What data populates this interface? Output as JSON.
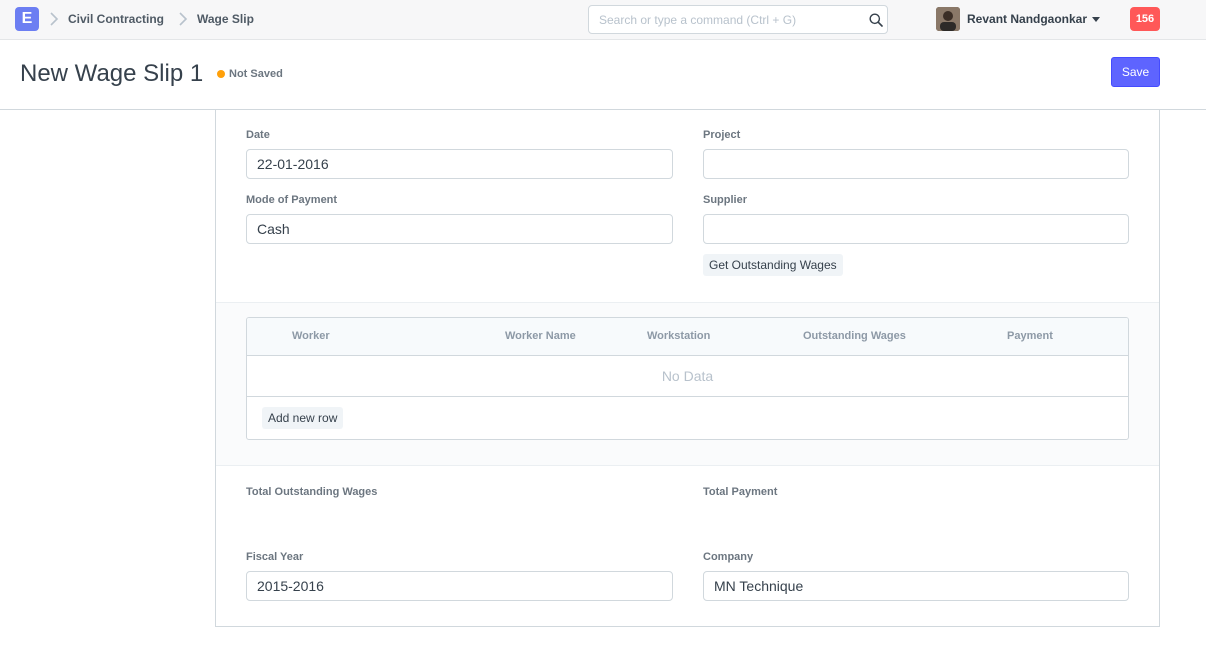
{
  "navbar": {
    "logo_letter": "E",
    "breadcrumbs": [
      "Civil Contracting",
      "Wage Slip"
    ],
    "search_placeholder": "Search or type a command (Ctrl + G)",
    "user_name": "Revant Nandgaonkar",
    "notification_count": "156"
  },
  "page": {
    "title": "New Wage Slip 1",
    "status": "Not Saved",
    "save_label": "Save"
  },
  "form": {
    "date": {
      "label": "Date",
      "value": "22-01-2016"
    },
    "project": {
      "label": "Project",
      "value": ""
    },
    "mode_of_payment": {
      "label": "Mode of Payment",
      "value": "Cash"
    },
    "supplier": {
      "label": "Supplier",
      "value": ""
    },
    "get_outstanding_label": "Get Outstanding Wages",
    "total_outstanding_label": "Total Outstanding Wages",
    "total_payment_label": "Total Payment",
    "fiscal_year": {
      "label": "Fiscal Year",
      "value": "2015-2016"
    },
    "company": {
      "label": "Company",
      "value": "MN Technique"
    }
  },
  "grid": {
    "columns": [
      "Worker",
      "Worker Name",
      "Workstation",
      "Outstanding Wages",
      "Payment"
    ],
    "empty_text": "No Data",
    "add_row_label": "Add new row"
  },
  "colors": {
    "primary": "#5e64ff",
    "logo": "#6c7ef2",
    "indicator": "#ffa00a",
    "badge": "#ff5858"
  }
}
